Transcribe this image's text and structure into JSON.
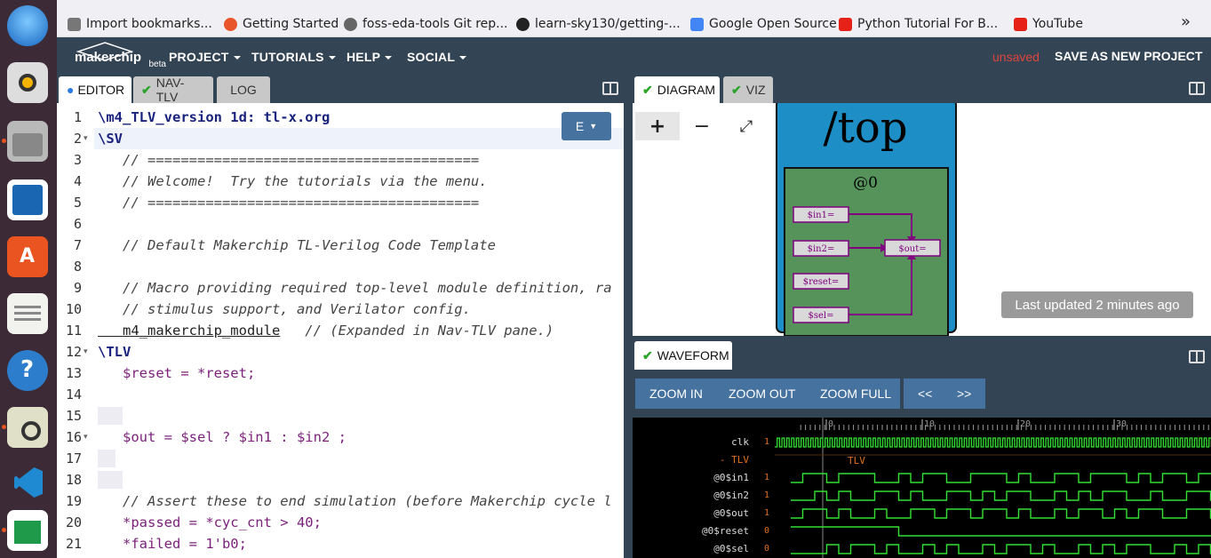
{
  "bookmarks": [
    {
      "label": "Import bookmarks...",
      "icon": "import-icon"
    },
    {
      "label": "Getting Started",
      "icon": "firefox-icon"
    },
    {
      "label": "foss-eda-tools Git rep...",
      "icon": "globe-icon"
    },
    {
      "label": "learn-sky130/getting-...",
      "icon": "github-icon"
    },
    {
      "label": "Google Open Source",
      "icon": "google-icon"
    },
    {
      "label": "Python Tutorial For B...",
      "icon": "youtube-icon"
    },
    {
      "label": "YouTube",
      "icon": "youtube-icon"
    }
  ],
  "bookmarks_overflow": "»",
  "app": {
    "logo": "makerchip",
    "logo_sub": "beta",
    "status": "unsaved",
    "save_label": "SAVE AS NEW PROJECT"
  },
  "menu": [
    "PROJECT",
    "TUTORIALS",
    "HELP",
    "SOCIAL"
  ],
  "left_tabs": [
    {
      "label": "EDITOR",
      "state": "active"
    },
    {
      "label": "NAV-TLV",
      "state": "check"
    },
    {
      "label": "LOG",
      "state": ""
    }
  ],
  "right_tabs": [
    {
      "label": "DIAGRAM",
      "state": "active"
    },
    {
      "label": "VIZ",
      "state": "check"
    }
  ],
  "editor_mode_button": "E",
  "code": [
    {
      "n": "1",
      "fold": "",
      "text": "\\m4_TLV_version 1d: tl-x.org",
      "cls": "kw"
    },
    {
      "n": "2",
      "fold": "▾",
      "text": "\\SV",
      "cls": "kw"
    },
    {
      "n": "3",
      "fold": "",
      "text": "   // ========================================",
      "cls": "cm"
    },
    {
      "n": "4",
      "fold": "",
      "text": "   // Welcome!  Try the tutorials via the menu.",
      "cls": "cm"
    },
    {
      "n": "5",
      "fold": "",
      "text": "   // ========================================",
      "cls": "cm"
    },
    {
      "n": "6",
      "fold": "",
      "text": "",
      "cls": ""
    },
    {
      "n": "7",
      "fold": "",
      "text": "   // Default Makerchip TL-Verilog Code Template",
      "cls": "cm"
    },
    {
      "n": "8",
      "fold": "",
      "text": "",
      "cls": ""
    },
    {
      "n": "9",
      "fold": "",
      "text": "   // Macro providing required top-level module definition, ra",
      "cls": "cm"
    },
    {
      "n": "10",
      "fold": "",
      "text": "   // stimulus support, and Verilator config.",
      "cls": "cm"
    },
    {
      "n": "11",
      "fold": "",
      "text": "   m4_makerchip_module   // (Expanded in Nav-TLV pane.)",
      "cls": "mixed"
    },
    {
      "n": "12",
      "fold": "▾",
      "text": "\\TLV",
      "cls": "kw"
    },
    {
      "n": "13",
      "fold": "",
      "text": "   $reset = *reset;",
      "cls": "sig"
    },
    {
      "n": "14",
      "fold": "",
      "text": "",
      "cls": ""
    },
    {
      "n": "15",
      "fold": "",
      "text": "",
      "cls": ""
    },
    {
      "n": "16",
      "fold": "▾",
      "text": "   $out = $sel ? $in1 : $in2 ;",
      "cls": "sig"
    },
    {
      "n": "17",
      "fold": "",
      "text": "",
      "cls": ""
    },
    {
      "n": "18",
      "fold": "",
      "text": "",
      "cls": ""
    },
    {
      "n": "19",
      "fold": "",
      "text": "   // Assert these to end simulation (before Makerchip cycle l",
      "cls": "cm"
    },
    {
      "n": "20",
      "fold": "",
      "text": "   *passed = *cyc_cnt > 40;",
      "cls": "sig"
    },
    {
      "n": "21",
      "fold": "",
      "text": "   *failed = 1'b0;",
      "cls": "sig"
    }
  ],
  "diagram": {
    "zoom_in": "+",
    "zoom_out": "−",
    "fit": "⤢",
    "module_title": "/top",
    "stage_label": "@0",
    "signals": [
      "$in1=",
      "$in2=",
      "$reset=",
      "$sel="
    ],
    "output_signal": "$out=",
    "last_updated": "Last updated 2 minutes ago",
    "colors": {
      "module": "#1e8fc6",
      "stage": "#55935a",
      "wire": "#800080"
    }
  },
  "waveform": {
    "tab_label": "WAVEFORM",
    "buttons": [
      "ZOOM IN",
      "ZOOM OUT",
      "ZOOM FULL"
    ],
    "nav_buttons": [
      "<<",
      ">>"
    ],
    "ticks": [
      "0",
      "10",
      "20",
      "30"
    ],
    "signals": [
      {
        "name": "clk",
        "value": "1"
      },
      {
        "name": "- TLV",
        "value": "TLV"
      },
      {
        "name": "@0$in1",
        "value": "1"
      },
      {
        "name": "@0$in2",
        "value": "1"
      },
      {
        "name": "@0$out",
        "value": "1"
      },
      {
        "name": "@0$reset",
        "value": "0"
      },
      {
        "name": "@0$sel",
        "value": "0"
      }
    ],
    "wave_color": "#33e033"
  }
}
